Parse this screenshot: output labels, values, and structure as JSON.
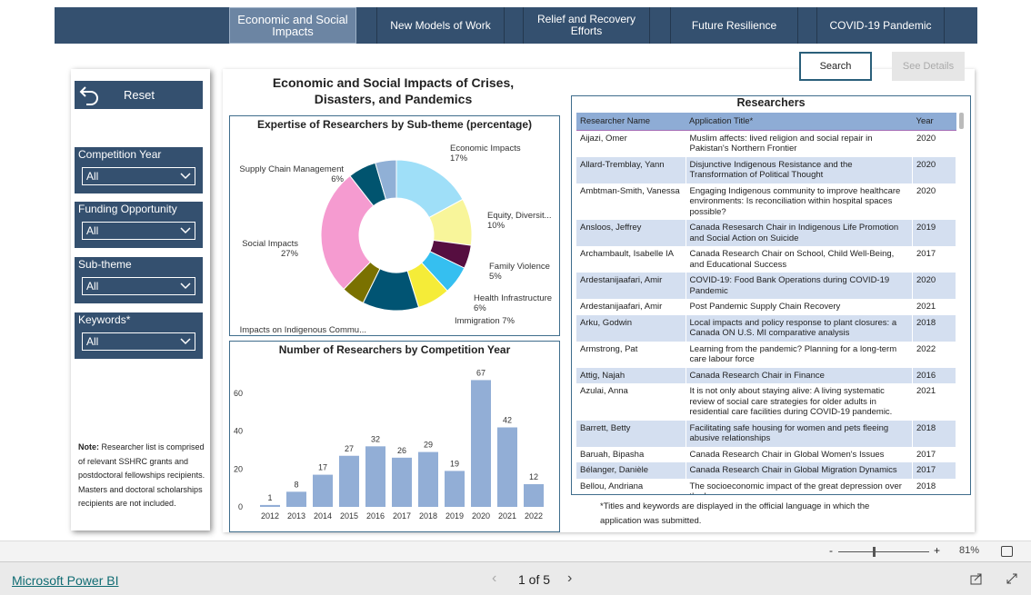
{
  "nav": {
    "tabs": [
      {
        "label": "Economic and Social Impacts",
        "active": true
      },
      {
        "label": "New Models of Work"
      },
      {
        "label": "Relief and Recovery Efforts"
      },
      {
        "label": "Future Resilience"
      },
      {
        "label": "COVID-19 Pandemic"
      }
    ]
  },
  "sidebar": {
    "reset_label": "Reset",
    "filters": [
      {
        "label": "Competition Year",
        "value": "All"
      },
      {
        "label": "Funding Opportunity",
        "value": "All"
      },
      {
        "label": "Sub-theme",
        "value": "All"
      },
      {
        "label": "Keywords*",
        "value": "All"
      }
    ],
    "note_bold": "Note:",
    "note_text": " Researcher list is comprised of relevant SSHRC grants and postdoctoral fellowships recipients. Masters and doctoral scholarships recipients are not included."
  },
  "page_title": "Economic and Social Impacts of Crises, Disasters, and Pandemics",
  "buttons": {
    "search": "Search",
    "see_details": "See Details"
  },
  "chart_data": [
    {
      "type": "pie",
      "title": "Expertise of Researchers by Sub-theme (percentage)",
      "donut": true,
      "slices": [
        {
          "name": "Economic Impacts",
          "label": "17%",
          "value": 17,
          "color": "#9fdff8"
        },
        {
          "name": "Equity, Diversit...",
          "label": "10%",
          "value": 10,
          "color": "#f8f59a"
        },
        {
          "name": "Family Violence",
          "label": "5%",
          "value": 5,
          "color": "#560e40"
        },
        {
          "name": "Health Infrastructure",
          "label": "6%",
          "value": 6,
          "color": "#35bff0"
        },
        {
          "name": "Immigration",
          "label": "7%",
          "value": 7,
          "color": "#f5ec38"
        },
        {
          "name": "Impacts on Indigenous Commu...",
          "label": "12%",
          "value": 12,
          "color": "#015473"
        },
        {
          "name": "",
          "label": "",
          "value": 5,
          "color": "#7a7100"
        },
        {
          "name": "Social Impacts",
          "label": "27%",
          "value": 27,
          "color": "#f59bd0"
        },
        {
          "name": "Supply Chain Management",
          "label": "6%",
          "value": 6,
          "color": "#01546f"
        },
        {
          "name": "",
          "label": "",
          "value": 4.5,
          "color": "#90b0d6"
        }
      ]
    },
    {
      "type": "bar",
      "title": "Number of Researchers by Competition Year",
      "categories": [
        "2012",
        "2013",
        "2014",
        "2015",
        "2016",
        "2017",
        "2018",
        "2019",
        "2020",
        "2021",
        "2022"
      ],
      "values": [
        1,
        8,
        17,
        27,
        32,
        26,
        29,
        19,
        67,
        42,
        12
      ],
      "yticks": [
        0,
        20,
        40,
        60
      ],
      "ylim": [
        0,
        70
      ],
      "color": "#92aed6",
      "grid": false
    }
  ],
  "researchers": {
    "title": "Researchers",
    "columns": [
      "Researcher Name",
      "Application Title*",
      "Year"
    ],
    "rows": [
      [
        "Aijazi, Omer",
        "Muslim affects: lived religion and social repair in Pakistan's Northern Frontier",
        "2020"
      ],
      [
        "Allard-Tremblay, Yann",
        "Disjunctive Indigenous Resistance and the Transformation of Political Thought",
        "2020"
      ],
      [
        "Ambtman-Smith, Vanessa",
        "Engaging Indigenous community to improve healthcare environments: Is reconciliation within hospital spaces possible?",
        "2020"
      ],
      [
        "Ansloos, Jeffrey",
        "Canada Resesarch Chair in Indigenous Life Promotion and Social Action on Suicide",
        "2019"
      ],
      [
        "Archambault, Isabelle IA",
        "Canada Research Chair on School, Child Well-Being, and Educational Success",
        "2017"
      ],
      [
        "Ardestanijaafari, Amir",
        "COVID-19: Food Bank Operations during COVID-19 Pandemic",
        "2020"
      ],
      [
        "Ardestanijaafari, Amir",
        "Post Pandemic Supply Chain Recovery",
        "2021"
      ],
      [
        "Arku, Godwin",
        "Local impacts and policy response to plant closures: a Canada ON U.S. MI comparative analysis",
        "2018"
      ],
      [
        "Armstrong, Pat",
        "Learning from the pandemic? Planning for a long-term care labour force",
        "2022"
      ],
      [
        "Attig, Najah",
        "Canada Research Chair in Finance",
        "2016"
      ],
      [
        "Azulai, Anna",
        "It is not only about staying alive: A living systematic review of social care strategies for older adults in residential care facilities during COVID-19 pandemic.",
        "2021"
      ],
      [
        "Barrett, Betty",
        "Facilitating safe housing for women and pets fleeing abusive relationships",
        "2018"
      ],
      [
        "Baruah, Bipasha",
        "Canada Research Chair in Global Women's Issues",
        "2017"
      ],
      [
        "Bélanger, Danièle",
        "Canada Research Chair in Global Migration Dynamics",
        "2017"
      ],
      [
        "Bellou, Andriana",
        "The socioeconomic impact of the great depression over the long run",
        "2018"
      ]
    ],
    "footnote": "*Titles and keywords are displayed in the official language in which the application was submitted."
  },
  "zoom": {
    "level": "81%",
    "percent": 81
  },
  "footer": {
    "brand": "Microsoft Power BI",
    "page": "1 of 5"
  }
}
